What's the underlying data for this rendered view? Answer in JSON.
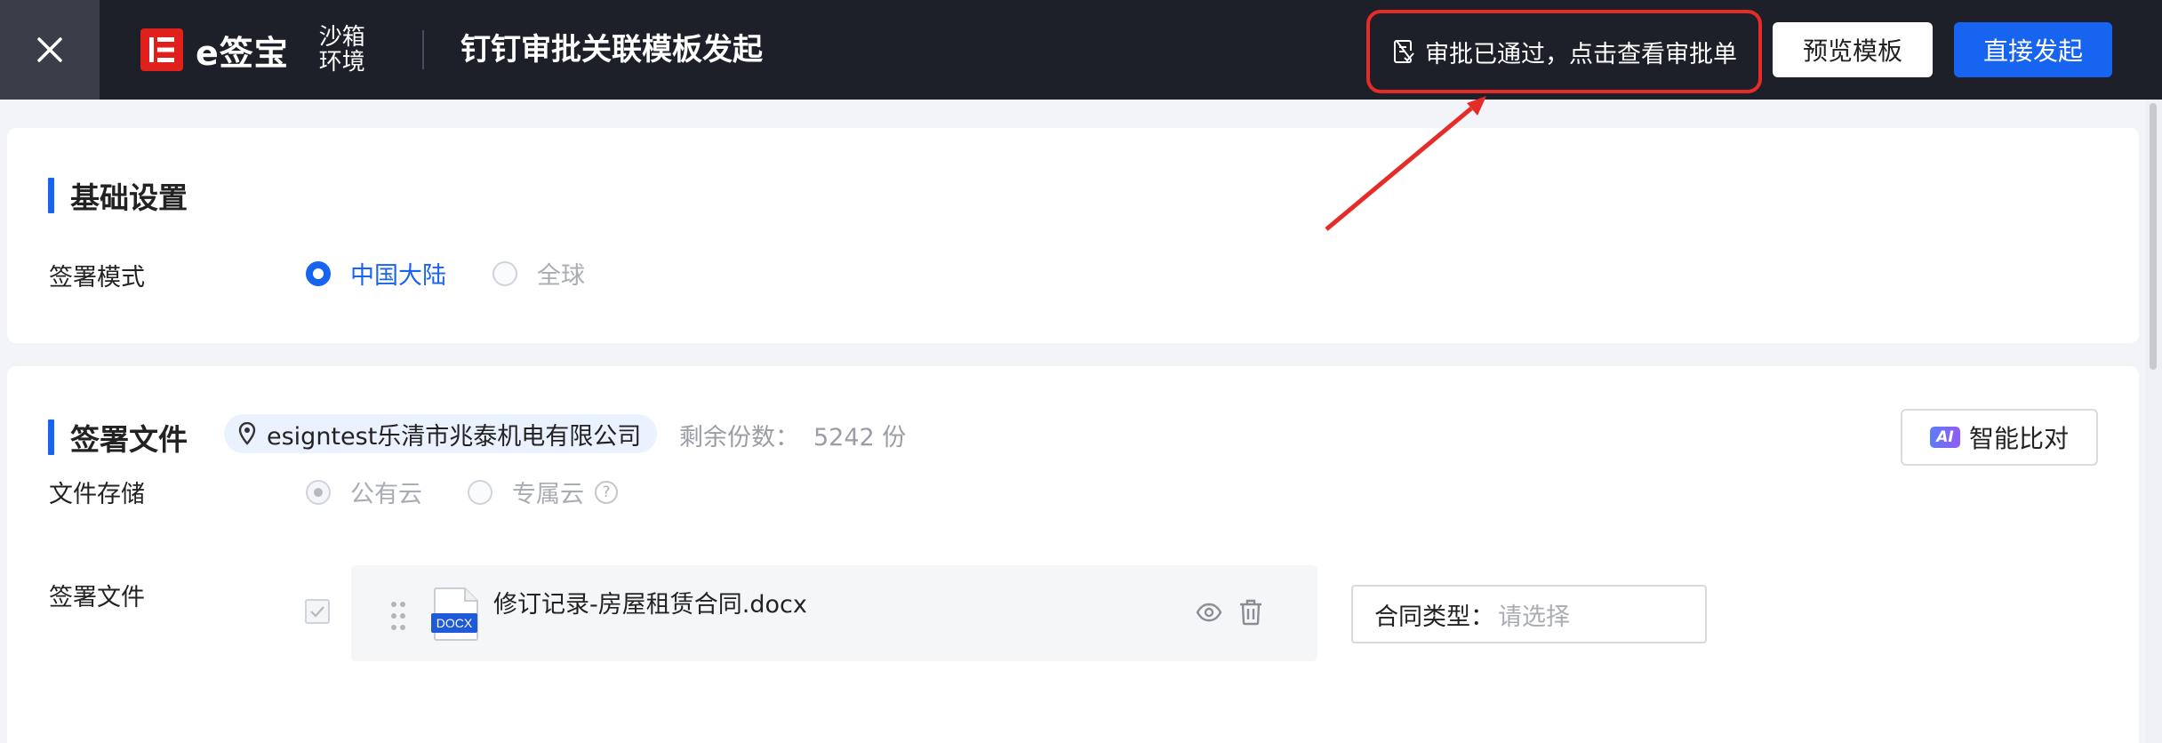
{
  "header": {
    "logo_text": "e签宝",
    "env_label": "沙箱环境",
    "page_title": "钉钉审批关联模板发起",
    "approval_status": "审批已通过，点击查看审批单",
    "preview_button": "预览模板",
    "launch_button": "直接发起"
  },
  "basic_settings": {
    "title": "基础设置",
    "sign_mode_label": "签署模式",
    "sign_mode_options": [
      "中国大陆",
      "全球"
    ],
    "sign_mode_selected": "中国大陆"
  },
  "sign_files": {
    "title": "签署文件",
    "org_name": "esigntest乐清市兆泰机电有限公司",
    "remaining_label": "剩余份数：",
    "remaining_value": "5242 份",
    "ai_badge": "AI",
    "ai_compare_button": "智能比对",
    "storage_label": "文件存储",
    "storage_options": [
      "公有云",
      "专属云"
    ],
    "storage_selected": "公有云",
    "files_label": "签署文件",
    "files": [
      {
        "icon_text": "DOCX",
        "name": "修订记录-房屋租赁合同.docx"
      }
    ],
    "contract_type_label": "合同类型：",
    "contract_type_placeholder": "请选择"
  },
  "colors": {
    "header_bg": "#1d2029",
    "primary": "#1764f0",
    "annotation_red": "#e52c28",
    "logo_red": "#e0201b"
  },
  "icons": [
    "close-icon",
    "logo-icon",
    "approval-doc-icon",
    "location-pin-icon",
    "help-icon",
    "checkbox-check-icon",
    "drag-handle-icon",
    "docx-file-icon",
    "eye-icon",
    "trash-icon"
  ]
}
